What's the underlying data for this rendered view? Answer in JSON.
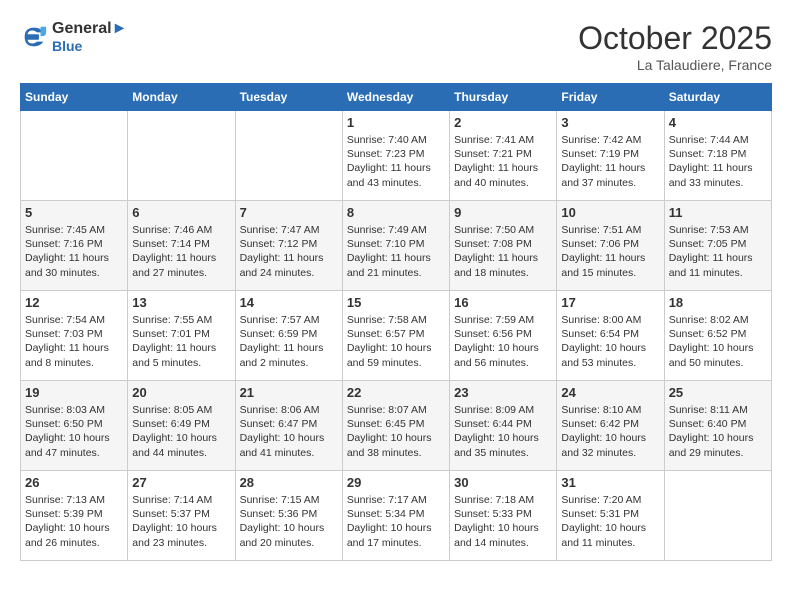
{
  "header": {
    "logo_line1": "General",
    "logo_line2": "Blue",
    "month": "October 2025",
    "location": "La Talaudiere, France"
  },
  "days_of_week": [
    "Sunday",
    "Monday",
    "Tuesday",
    "Wednesday",
    "Thursday",
    "Friday",
    "Saturday"
  ],
  "weeks": [
    [
      {
        "day": "",
        "sunrise": "",
        "sunset": "",
        "daylight": ""
      },
      {
        "day": "",
        "sunrise": "",
        "sunset": "",
        "daylight": ""
      },
      {
        "day": "",
        "sunrise": "",
        "sunset": "",
        "daylight": ""
      },
      {
        "day": "1",
        "sunrise": "Sunrise: 7:40 AM",
        "sunset": "Sunset: 7:23 PM",
        "daylight": "Daylight: 11 hours and 43 minutes."
      },
      {
        "day": "2",
        "sunrise": "Sunrise: 7:41 AM",
        "sunset": "Sunset: 7:21 PM",
        "daylight": "Daylight: 11 hours and 40 minutes."
      },
      {
        "day": "3",
        "sunrise": "Sunrise: 7:42 AM",
        "sunset": "Sunset: 7:19 PM",
        "daylight": "Daylight: 11 hours and 37 minutes."
      },
      {
        "day": "4",
        "sunrise": "Sunrise: 7:44 AM",
        "sunset": "Sunset: 7:18 PM",
        "daylight": "Daylight: 11 hours and 33 minutes."
      }
    ],
    [
      {
        "day": "5",
        "sunrise": "Sunrise: 7:45 AM",
        "sunset": "Sunset: 7:16 PM",
        "daylight": "Daylight: 11 hours and 30 minutes."
      },
      {
        "day": "6",
        "sunrise": "Sunrise: 7:46 AM",
        "sunset": "Sunset: 7:14 PM",
        "daylight": "Daylight: 11 hours and 27 minutes."
      },
      {
        "day": "7",
        "sunrise": "Sunrise: 7:47 AM",
        "sunset": "Sunset: 7:12 PM",
        "daylight": "Daylight: 11 hours and 24 minutes."
      },
      {
        "day": "8",
        "sunrise": "Sunrise: 7:49 AM",
        "sunset": "Sunset: 7:10 PM",
        "daylight": "Daylight: 11 hours and 21 minutes."
      },
      {
        "day": "9",
        "sunrise": "Sunrise: 7:50 AM",
        "sunset": "Sunset: 7:08 PM",
        "daylight": "Daylight: 11 hours and 18 minutes."
      },
      {
        "day": "10",
        "sunrise": "Sunrise: 7:51 AM",
        "sunset": "Sunset: 7:06 PM",
        "daylight": "Daylight: 11 hours and 15 minutes."
      },
      {
        "day": "11",
        "sunrise": "Sunrise: 7:53 AM",
        "sunset": "Sunset: 7:05 PM",
        "daylight": "Daylight: 11 hours and 11 minutes."
      }
    ],
    [
      {
        "day": "12",
        "sunrise": "Sunrise: 7:54 AM",
        "sunset": "Sunset: 7:03 PM",
        "daylight": "Daylight: 11 hours and 8 minutes."
      },
      {
        "day": "13",
        "sunrise": "Sunrise: 7:55 AM",
        "sunset": "Sunset: 7:01 PM",
        "daylight": "Daylight: 11 hours and 5 minutes."
      },
      {
        "day": "14",
        "sunrise": "Sunrise: 7:57 AM",
        "sunset": "Sunset: 6:59 PM",
        "daylight": "Daylight: 11 hours and 2 minutes."
      },
      {
        "day": "15",
        "sunrise": "Sunrise: 7:58 AM",
        "sunset": "Sunset: 6:57 PM",
        "daylight": "Daylight: 10 hours and 59 minutes."
      },
      {
        "day": "16",
        "sunrise": "Sunrise: 7:59 AM",
        "sunset": "Sunset: 6:56 PM",
        "daylight": "Daylight: 10 hours and 56 minutes."
      },
      {
        "day": "17",
        "sunrise": "Sunrise: 8:00 AM",
        "sunset": "Sunset: 6:54 PM",
        "daylight": "Daylight: 10 hours and 53 minutes."
      },
      {
        "day": "18",
        "sunrise": "Sunrise: 8:02 AM",
        "sunset": "Sunset: 6:52 PM",
        "daylight": "Daylight: 10 hours and 50 minutes."
      }
    ],
    [
      {
        "day": "19",
        "sunrise": "Sunrise: 8:03 AM",
        "sunset": "Sunset: 6:50 PM",
        "daylight": "Daylight: 10 hours and 47 minutes."
      },
      {
        "day": "20",
        "sunrise": "Sunrise: 8:05 AM",
        "sunset": "Sunset: 6:49 PM",
        "daylight": "Daylight: 10 hours and 44 minutes."
      },
      {
        "day": "21",
        "sunrise": "Sunrise: 8:06 AM",
        "sunset": "Sunset: 6:47 PM",
        "daylight": "Daylight: 10 hours and 41 minutes."
      },
      {
        "day": "22",
        "sunrise": "Sunrise: 8:07 AM",
        "sunset": "Sunset: 6:45 PM",
        "daylight": "Daylight: 10 hours and 38 minutes."
      },
      {
        "day": "23",
        "sunrise": "Sunrise: 8:09 AM",
        "sunset": "Sunset: 6:44 PM",
        "daylight": "Daylight: 10 hours and 35 minutes."
      },
      {
        "day": "24",
        "sunrise": "Sunrise: 8:10 AM",
        "sunset": "Sunset: 6:42 PM",
        "daylight": "Daylight: 10 hours and 32 minutes."
      },
      {
        "day": "25",
        "sunrise": "Sunrise: 8:11 AM",
        "sunset": "Sunset: 6:40 PM",
        "daylight": "Daylight: 10 hours and 29 minutes."
      }
    ],
    [
      {
        "day": "26",
        "sunrise": "Sunrise: 7:13 AM",
        "sunset": "Sunset: 5:39 PM",
        "daylight": "Daylight: 10 hours and 26 minutes."
      },
      {
        "day": "27",
        "sunrise": "Sunrise: 7:14 AM",
        "sunset": "Sunset: 5:37 PM",
        "daylight": "Daylight: 10 hours and 23 minutes."
      },
      {
        "day": "28",
        "sunrise": "Sunrise: 7:15 AM",
        "sunset": "Sunset: 5:36 PM",
        "daylight": "Daylight: 10 hours and 20 minutes."
      },
      {
        "day": "29",
        "sunrise": "Sunrise: 7:17 AM",
        "sunset": "Sunset: 5:34 PM",
        "daylight": "Daylight: 10 hours and 17 minutes."
      },
      {
        "day": "30",
        "sunrise": "Sunrise: 7:18 AM",
        "sunset": "Sunset: 5:33 PM",
        "daylight": "Daylight: 10 hours and 14 minutes."
      },
      {
        "day": "31",
        "sunrise": "Sunrise: 7:20 AM",
        "sunset": "Sunset: 5:31 PM",
        "daylight": "Daylight: 10 hours and 11 minutes."
      },
      {
        "day": "",
        "sunrise": "",
        "sunset": "",
        "daylight": ""
      }
    ]
  ]
}
